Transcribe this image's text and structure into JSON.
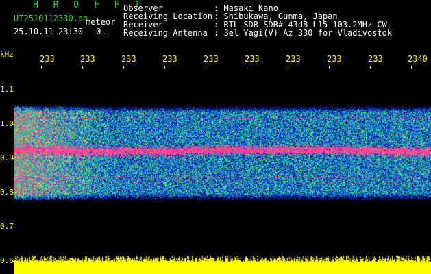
{
  "header": {
    "title": "H R O F F T",
    "filename": "UT2510112330.pn",
    "meteor_label": "meteor",
    "timestamp": "25.10.11 23:30",
    "meteor_count": "0",
    "count_suffix": "..",
    "info": {
      "observer_label": "Observer",
      "observer_value": ": Masaki Kano",
      "location_label": "Receiving Location",
      "location_value": ": Shibukawa, Gunma, Japan",
      "receiver_label": "Receiver",
      "receiver_value": ": RTL-SDR SDR# 43dB L15 103.2MHz CW",
      "antenna_label": "Receiving Antenna",
      "antenna_value": ": 3el Yagi(V) Az 330 for Vladivostok"
    }
  },
  "axis": {
    "unit": "kHz",
    "y_labels": [
      "1.1",
      "1.0",
      "0.9",
      "0.8",
      "0.7",
      "0.6"
    ],
    "x_labels": [
      "233",
      "233",
      "233",
      "233",
      "233",
      "233",
      "233",
      "233",
      "233",
      "2340"
    ]
  },
  "colors": {
    "background": "#000000",
    "text_green": "#2fd92f",
    "text_white": "#ffffff",
    "axis_yellow": "#ffff00",
    "signal_strong": "#ff2a88",
    "signal_mid": "#19e08a",
    "signal_low": "#1a3cff",
    "noise_bar": "#ffff00"
  }
}
